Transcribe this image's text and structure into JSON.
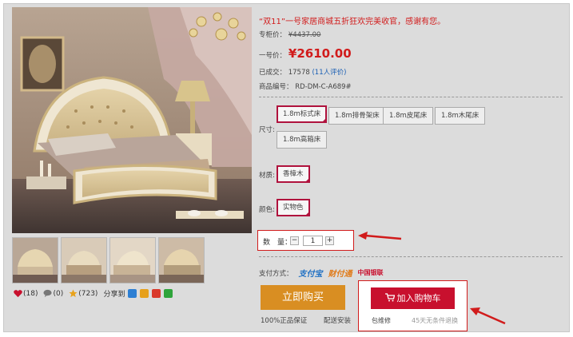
{
  "promo": "“双11”一号家居商城五折狂欢完美收官，感谢有您。",
  "counter_price": {
    "label": "专柜价：",
    "value": "¥4437.00"
  },
  "our_price": {
    "label": "一号价：",
    "value": "¥2610.00"
  },
  "sold": {
    "label": "已成交：",
    "value": "17578",
    "reviews": "(11人评价)"
  },
  "sku": {
    "label": "商品编号：",
    "value": "RD-DM-C-A689#"
  },
  "size": {
    "label": "尺寸:",
    "options": [
      "1.8m标式床",
      "1.8m排骨架床",
      "1.8m皮尾床",
      "1.8m木尾床",
      "1.8m高箱床"
    ],
    "selected": "1.8m标式床"
  },
  "material": {
    "label": "材质:",
    "options": [
      "香樟木"
    ]
  },
  "color": {
    "label": "颜色:",
    "options": [
      "实物色"
    ]
  },
  "quantity": {
    "label": "数　量：",
    "value": "1",
    "minus": "−",
    "plus": "+"
  },
  "payment": {
    "label": "支付方式：",
    "methods": [
      "支付宝",
      "财付通",
      "中国银联"
    ]
  },
  "buy_now": "立即购买",
  "guarantees": [
    "100%正品保证",
    "配送安装"
  ],
  "add_to_cart": "加入购物车",
  "cart_notes": [
    "包维修",
    "45天无条件退换"
  ],
  "social": {
    "likes": "(18)",
    "comments": "(0)",
    "rating": "(723)",
    "share": "分享到"
  },
  "colors": {
    "accent_red": "#d11b1b",
    "cart_red": "#c8102e",
    "buy_orange": "#d98e22",
    "selected_border": "#b0123d"
  }
}
